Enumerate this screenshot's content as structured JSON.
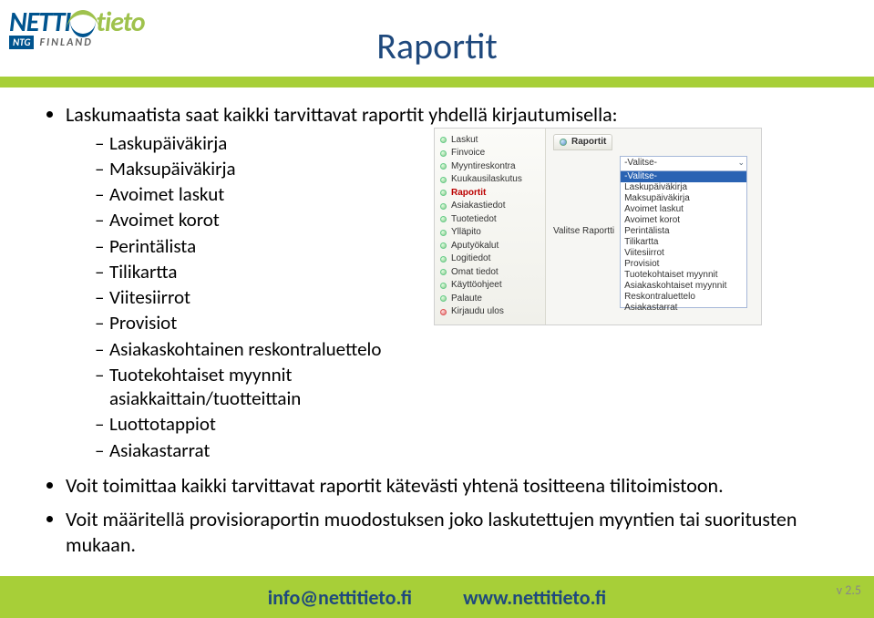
{
  "slide": {
    "title": "Raportit",
    "intro": "Laskumaatista saat kaikki tarvittavat raportit yhdellä kirjautumisella:",
    "report_types": [
      "Laskupäiväkirja",
      "Maksupäiväkirja",
      "Avoimet laskut",
      "Avoimet korot",
      "Perintälista",
      "Tilikartta",
      "Viitesiirrot",
      "Provisiot",
      "Asiakaskohtainen reskontraluettelo",
      "Tuotekohtaiset myynnit asiakkaittain/tuotteittain",
      "Luottotappiot",
      "Asiakastarrat"
    ],
    "bullets_after": [
      "Voit toimittaa kaikki tarvittavat raportit kätevästi yhtenä tositteena tilitoimistoon.",
      "Voit määritellä provisioraportin muodostuksen joko laskutettujen myyntien tai suoritusten mukaan."
    ]
  },
  "logo": {
    "part1": "NETTI",
    "part2": "tieto",
    "sub1": "NTG",
    "sub2": "FINLAND"
  },
  "ui_screenshot": {
    "nav": [
      {
        "label": "Laskut"
      },
      {
        "label": "Finvoice"
      },
      {
        "label": "Myyntireskontra"
      },
      {
        "label": "Kuukausilaskutus"
      },
      {
        "label": "Raportit",
        "selected": true
      },
      {
        "label": "Asiakastiedot"
      },
      {
        "label": "Tuotetiedot"
      },
      {
        "label": "Ylläpito"
      },
      {
        "label": "Aputyökalut"
      },
      {
        "label": "Logitiedot"
      },
      {
        "label": "Omat tiedot"
      },
      {
        "label": "Käyttöohjeet"
      },
      {
        "label": "Palaute"
      },
      {
        "label": "Kirjaudu ulos",
        "red": true
      }
    ],
    "tab_title": "Raportit",
    "select_label": "Valitse Raportti",
    "select_value": "-Valitse-",
    "options": [
      {
        "label": "-Valitse-",
        "selected": true
      },
      {
        "label": "Laskupäiväkirja"
      },
      {
        "label": "Maksupäiväkirja"
      },
      {
        "label": "Avoimet laskut"
      },
      {
        "label": "Avoimet korot"
      },
      {
        "label": "Perintälista"
      },
      {
        "label": "Tilikartta"
      },
      {
        "label": "Viitesiirrot"
      },
      {
        "label": "Provisiot"
      },
      {
        "label": "Tuotekohtaiset myynnit"
      },
      {
        "label": "Asiakaskohtaiset myynnit"
      },
      {
        "label": "Reskontraluettelo"
      },
      {
        "label": "Asiakastarrat"
      }
    ]
  },
  "footer": {
    "email": "info@nettitieto.fi",
    "url": "www.nettitieto.fi",
    "version": "v 2.5"
  }
}
